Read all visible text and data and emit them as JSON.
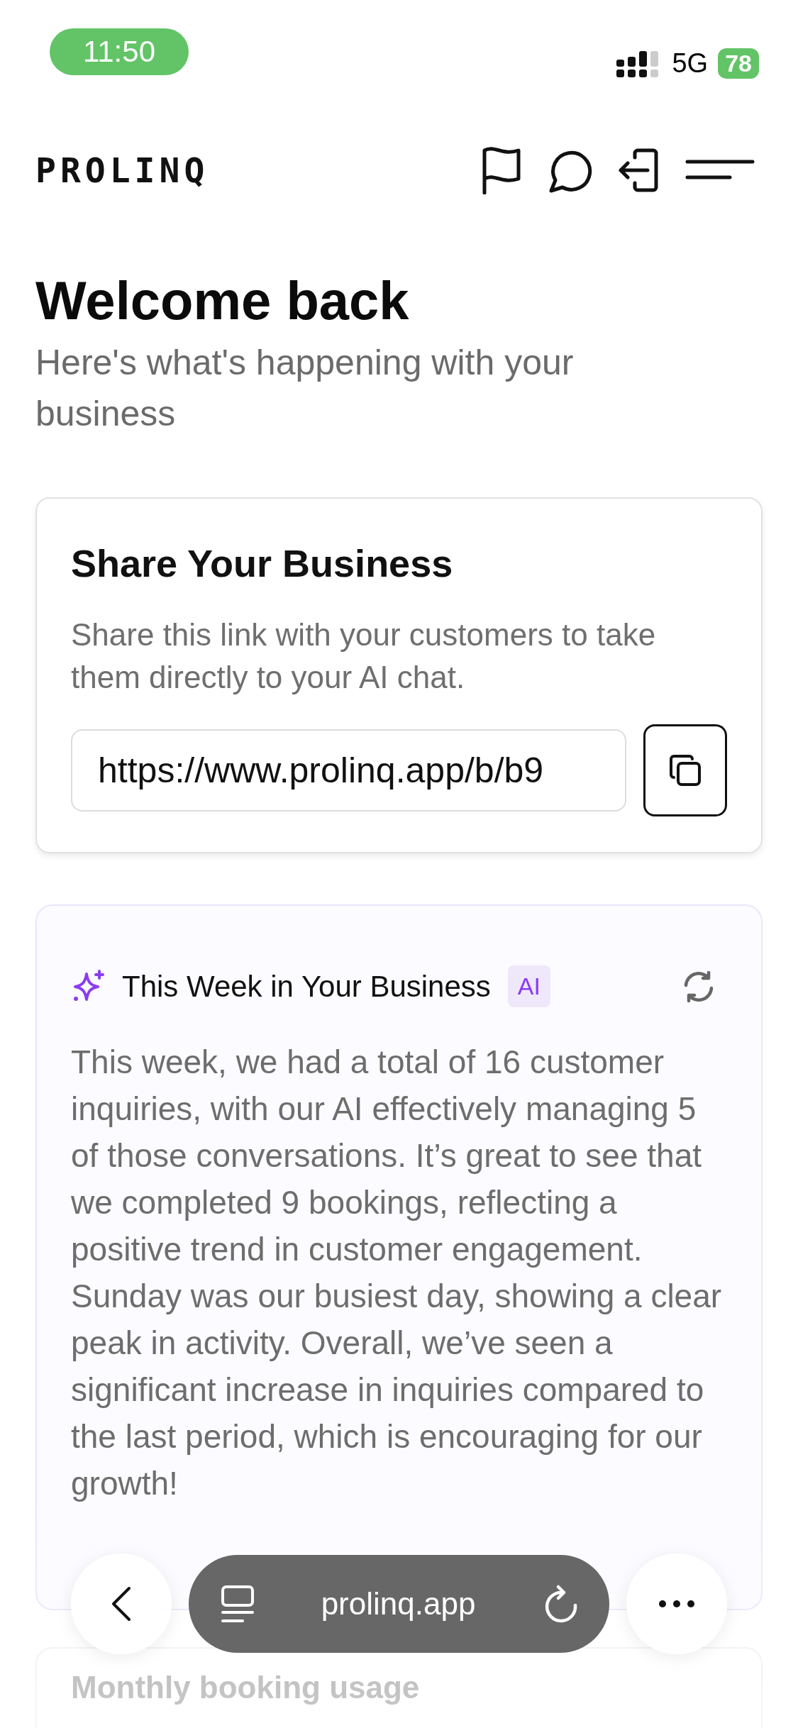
{
  "status_bar": {
    "time": "11:50",
    "network": "5G",
    "battery": "78"
  },
  "header": {
    "logo": "PROLINQ"
  },
  "welcome": {
    "title": "Welcome back",
    "subtitle": "Here's what's happening with your business"
  },
  "share_card": {
    "title": "Share Your Business",
    "description": "Share this link with your customers to take them directly to your AI chat.",
    "link": "https://www.prolinq.app/b/b9"
  },
  "summary_card": {
    "title": "This Week in Your Business",
    "badge": "AI",
    "body": "This week, we had a total of 16 customer inquiries, with our AI effectively managing 5 of those conversations. It’s great to see that we completed 9 bookings, reflecting a positive trend in customer engagement. Sunday was our busiest day, showing a clear peak in activity. Overall, we’ve seen a significant increase in inquiries compared to the last period, which is encouraging for our growth!"
  },
  "usage_card": {
    "title": "Monthly booking usage"
  },
  "browser_bar": {
    "url": "prolinq.app"
  }
}
